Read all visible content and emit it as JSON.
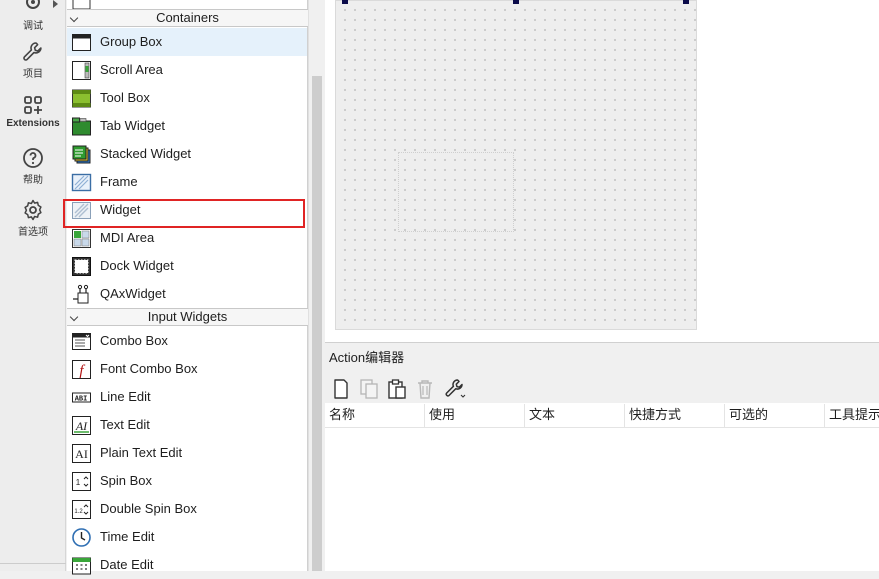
{
  "modebar": {
    "items": [
      {
        "label": "调试",
        "icon": "debug-icon"
      },
      {
        "label": "项目",
        "icon": "wrench-icon"
      },
      {
        "label": "Extensions",
        "icon": "extensions-icon"
      },
      {
        "label": "帮助",
        "icon": "help-icon"
      },
      {
        "label": "首选项",
        "icon": "gear-icon"
      }
    ]
  },
  "widgetbox": {
    "categories": [
      {
        "label": "Containers"
      },
      {
        "label": "Input Widgets"
      }
    ],
    "containers": [
      {
        "label": "Group Box",
        "icon": "group-box-icon"
      },
      {
        "label": "Scroll Area",
        "icon": "scroll-area-icon"
      },
      {
        "label": "Tool Box",
        "icon": "tool-box-icon"
      },
      {
        "label": "Tab Widget",
        "icon": "tab-widget-icon"
      },
      {
        "label": "Stacked Widget",
        "icon": "stacked-widget-icon"
      },
      {
        "label": "Frame",
        "icon": "frame-icon"
      },
      {
        "label": "Widget",
        "icon": "widget-icon"
      },
      {
        "label": "MDI Area",
        "icon": "mdi-area-icon"
      },
      {
        "label": "Dock Widget",
        "icon": "dock-widget-icon"
      },
      {
        "label": "QAxWidget",
        "icon": "qaxwidget-icon"
      }
    ],
    "inputs": [
      {
        "label": "Combo Box",
        "icon": "combo-box-icon"
      },
      {
        "label": "Font Combo Box",
        "icon": "font-combo-box-icon"
      },
      {
        "label": "Line Edit",
        "icon": "line-edit-icon"
      },
      {
        "label": "Text Edit",
        "icon": "text-edit-icon"
      },
      {
        "label": "Plain Text Edit",
        "icon": "plain-text-edit-icon"
      },
      {
        "label": "Spin Box",
        "icon": "spin-box-icon"
      },
      {
        "label": "Double Spin Box",
        "icon": "double-spin-box-icon"
      },
      {
        "label": "Time Edit",
        "icon": "time-edit-icon"
      },
      {
        "label": "Date Edit",
        "icon": "date-edit-icon"
      }
    ],
    "selected_item": "Group Box",
    "highlighted_item": "Widget"
  },
  "action_editor": {
    "title": "Action编辑器",
    "toolbar": [
      "new-action-icon",
      "copy-icon",
      "paste-icon",
      "delete-icon",
      "configure-icon"
    ],
    "columns": [
      "名称",
      "使用",
      "文本",
      "快捷方式",
      "可选的",
      "工具提示"
    ]
  },
  "colors": {
    "highlight_border": "#e02424",
    "selection_bg": "#e5f1fb",
    "handle": "#0b0b4a"
  }
}
